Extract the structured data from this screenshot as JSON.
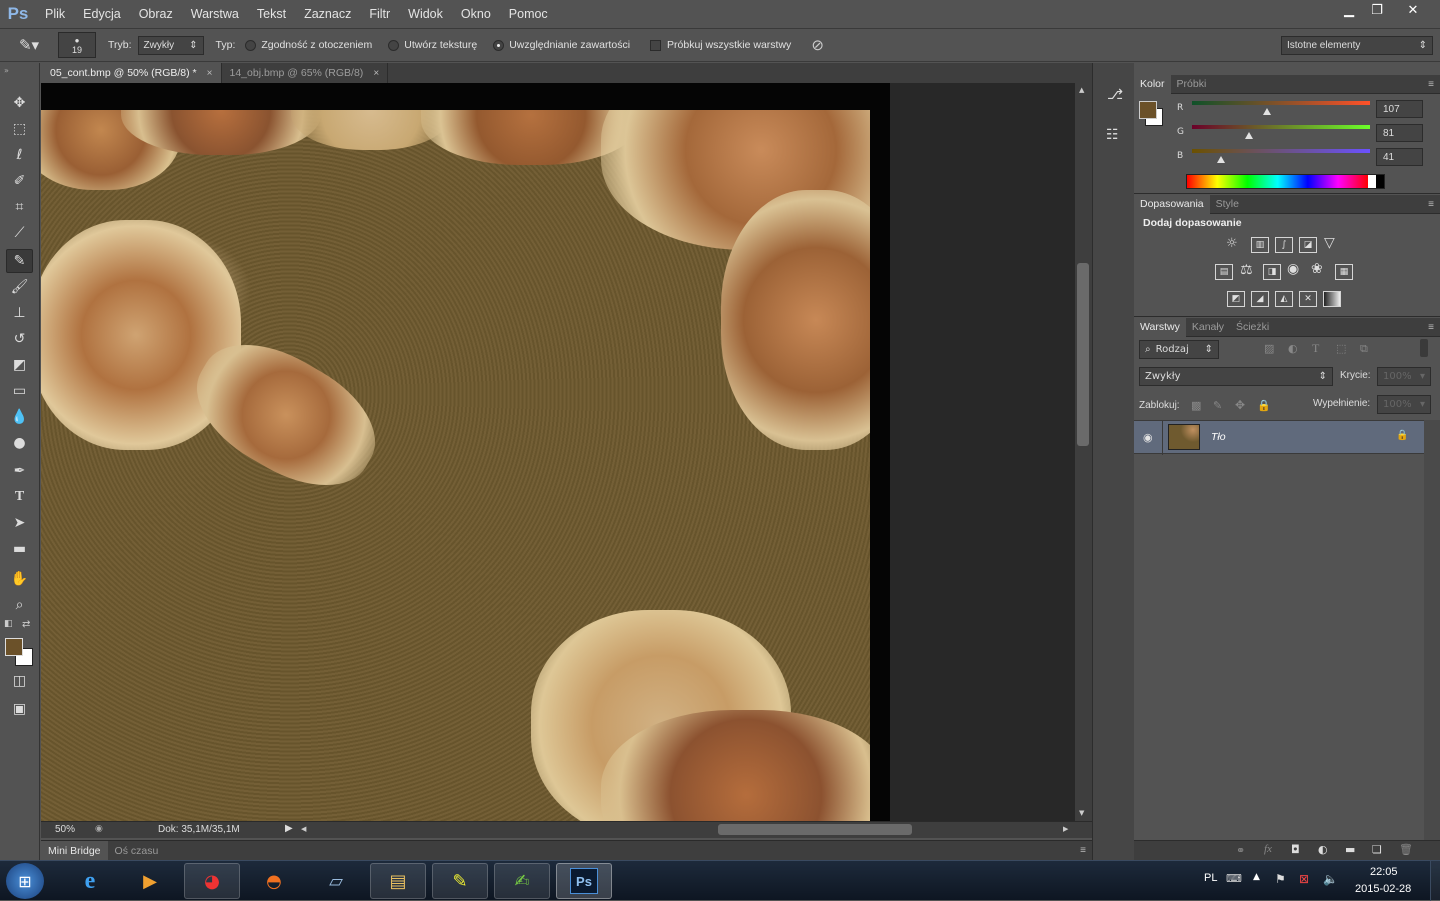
{
  "app": {
    "logo": "Ps"
  },
  "menu": [
    "Plik",
    "Edycja",
    "Obraz",
    "Warstwa",
    "Tekst",
    "Zaznacz",
    "Filtr",
    "Widok",
    "Okno",
    "Pomoc"
  ],
  "window_controls": {
    "minimize": "▁",
    "restore": "❐",
    "close": "✕"
  },
  "options": {
    "brush_size": "19",
    "mode_label": "Tryb:",
    "mode_value": "Zwykły",
    "type_label": "Typ:",
    "type_options": [
      "Zgodność z otoczeniem",
      "Utwórz teksturę",
      "Uwzględnianie zawartości"
    ],
    "type_selected": "Uwzględnianie zawartości",
    "sample_all": "Próbkuj wszystkie warstwy",
    "workspace": "Istotne elementy"
  },
  "tabs": [
    {
      "label": "05_cont.bmp @ 50% (RGB/8) *",
      "close": "×",
      "active": true
    },
    {
      "label": "14_obj.bmp @ 65% (RGB/8)",
      "close": "×",
      "active": false
    }
  ],
  "status": {
    "zoom": "50%",
    "doc": "Dok: 35,1M/35,1M"
  },
  "bottom_tabs": [
    "Mini Bridge",
    "Oś czasu"
  ],
  "color_panel": {
    "tabs": [
      "Kolor",
      "Próbki"
    ],
    "r_label": "R",
    "g_label": "G",
    "b_label": "B",
    "r": 107,
    "g": 81,
    "b": 41,
    "foreground": "#6b5129"
  },
  "adjust_panel": {
    "tabs": [
      "Dopasowania",
      "Style"
    ],
    "heading": "Dodaj dopasowanie",
    "icons": [
      "brightness-icon",
      "levels-icon",
      "curves-icon",
      "exposure-icon",
      "vibrance-icon",
      "hue-saturation-icon",
      "color-balance-icon",
      "black-white-icon",
      "photo-filter-icon",
      "channel-mixer-icon",
      "color-lookup-icon",
      "invert-icon",
      "posterize-icon",
      "threshold-icon",
      "selective-color-icon",
      "gradient-map-icon"
    ]
  },
  "layers_panel": {
    "tabs": [
      "Warstwy",
      "Kanały",
      "Ścieżki"
    ],
    "kind_filter": "Rodzaj",
    "blend_mode": "Zwykły",
    "opacity_label": "Krycie:",
    "opacity_value": "100%",
    "lock_label": "Zablokuj:",
    "fill_label": "Wypełnienie:",
    "fill_value": "100%",
    "layers": [
      {
        "name": "Tło",
        "visible": true,
        "locked": true
      }
    ]
  },
  "taskbar": {
    "lang": "PL",
    "time": "22:05",
    "date": "2015-02-28",
    "apps": [
      "windows-start-icon",
      "ie-icon",
      "media-player-icon",
      "chrome-icon",
      "firefox-icon",
      "notepad-icon",
      "explorer-icon",
      "tool-icon",
      "editor-icon",
      "photoshop-icon"
    ]
  }
}
